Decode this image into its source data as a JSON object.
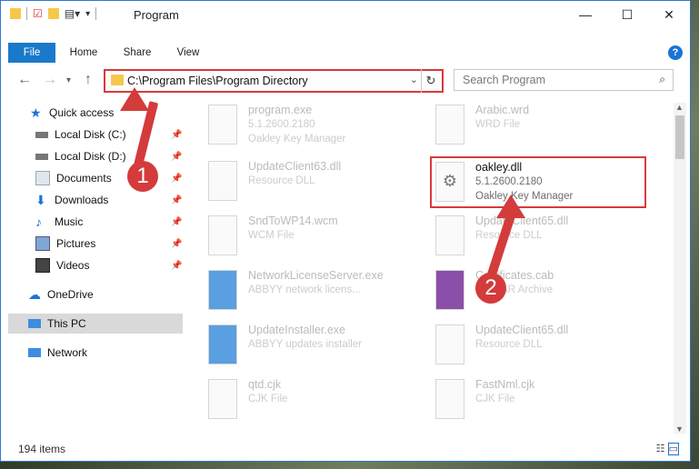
{
  "window": {
    "title": "Program",
    "controls": {
      "minimize": "—",
      "maximize": "☐",
      "close": "✕"
    }
  },
  "ribbon": {
    "tabs": [
      "File",
      "Home",
      "Share",
      "View"
    ],
    "help": "?"
  },
  "address": {
    "path": "C:\\Program Files\\Program Directory",
    "search_placeholder": "Search Program"
  },
  "sidebar": {
    "items": [
      {
        "label": "Quick access",
        "icon": "star-icon",
        "pinned": false
      },
      {
        "label": "Local Disk (C:)",
        "icon": "drive-icon",
        "pinned": true
      },
      {
        "label": "Local Disk (D:)",
        "icon": "drive-icon",
        "pinned": true
      },
      {
        "label": "Documents",
        "icon": "document-icon",
        "pinned": true
      },
      {
        "label": "Downloads",
        "icon": "download-icon",
        "pinned": true
      },
      {
        "label": "Music",
        "icon": "music-icon",
        "pinned": true
      },
      {
        "label": "Pictures",
        "icon": "pictures-icon",
        "pinned": true
      },
      {
        "label": "Videos",
        "icon": "video-icon",
        "pinned": true
      },
      {
        "label": "OneDrive",
        "icon": "cloud-icon",
        "pinned": false
      },
      {
        "label": "This PC",
        "icon": "computer-icon",
        "pinned": false,
        "selected": true
      },
      {
        "label": "Network",
        "icon": "network-icon",
        "pinned": false
      }
    ]
  },
  "files": [
    {
      "name": "program.exe",
      "line2": "5.1.2600.2180",
      "line3": "Oakley Key Manager"
    },
    {
      "name": "Arabic.wrd",
      "line2": "WRD File",
      "line3": ""
    },
    {
      "name": "UpdateClient63.dll",
      "line2": "Resource DLL",
      "line3": ""
    },
    {
      "name": "oakley.dll",
      "line2": "5.1.2600.2180",
      "line3": "Oakley Key Manager",
      "highlighted": true
    },
    {
      "name": "SndToWP14.wcm",
      "line2": "WCM File",
      "line3": ""
    },
    {
      "name": "UpdateClient65.dll",
      "line2": "Resource DLL",
      "line3": ""
    },
    {
      "name": "NetworkLicenseServer.exe",
      "line2": "ABBYY network licens...",
      "line3": ""
    },
    {
      "name": "Certificates.cab",
      "line2": "WinRAR Archive",
      "line3": ""
    },
    {
      "name": "UpdateInstaller.exe",
      "line2": "ABBYY updates installer",
      "line3": ""
    },
    {
      "name": "UpdateClient65.dll",
      "line2": "Resource DLL",
      "line3": ""
    },
    {
      "name": "qtd.cjk",
      "line2": "CJK File",
      "line3": ""
    },
    {
      "name": "FastNml.cjk",
      "line2": "CJK File",
      "line3": ""
    }
  ],
  "status": {
    "item_count": "194 items"
  },
  "annotations": {
    "step1": "1",
    "step2": "2"
  },
  "colors": {
    "accent": "#1979ca",
    "highlight": "#d83a3a"
  }
}
